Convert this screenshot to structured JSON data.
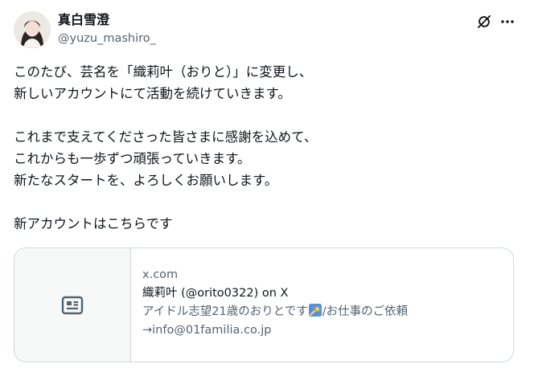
{
  "author": {
    "display_name": "真白雪澄",
    "handle": "@yuzu_mashiro_"
  },
  "icons": {
    "avatar": "profile-photo",
    "grok": "grok-icon",
    "more": "more-horizontal-icon",
    "card_placeholder": "article-icon",
    "emoji": "shooting-star-emoji"
  },
  "tweet": {
    "lines": [
      "このたび、芸名を「織莉叶（おりと）」に変更し、",
      "新しいアカウントにて活動を続けていきます。",
      "",
      "これまで支えてくださった皆さまに感謝を込めて、",
      "これからも一歩ずつ頑張っていきます。",
      "新たなスタートを、よろしくお願いします。",
      "",
      "新アカウントはこちらです"
    ]
  },
  "card": {
    "domain": "x.com",
    "title": "織莉叶 (@orito0322) on X",
    "description_before_emoji": "アイドル志望21歳のおりとです",
    "description_after_emoji": "/お仕事のご依頼→info@01familia.co.jp"
  },
  "colors": {
    "text_primary": "#0f1419",
    "text_secondary": "#536471",
    "border": "#cfd9de",
    "card_thumb_bg": "#f7f9f9"
  }
}
